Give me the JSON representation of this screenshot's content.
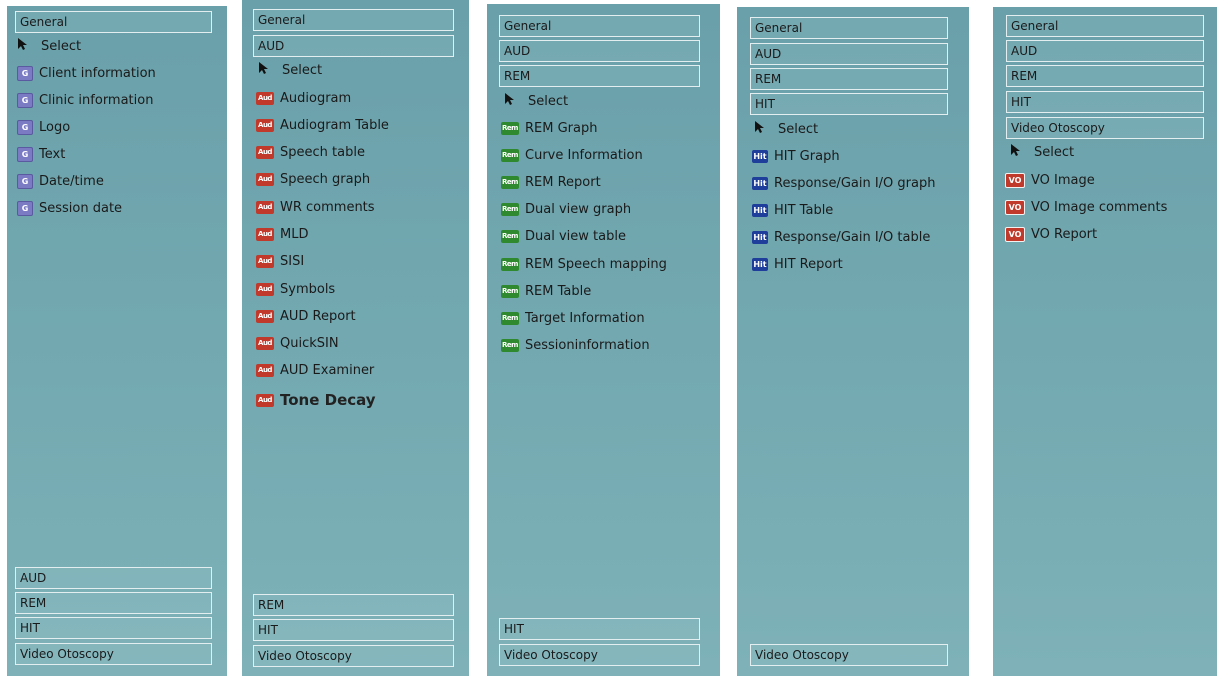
{
  "colors": {
    "panel": "#74a9b1",
    "aud_icon": "#c0392b",
    "rem_icon": "#2f8a2f",
    "hit_icon": "#1f3d9a",
    "general_icon": "#7b7bc4"
  },
  "icons": {
    "badge_general": "G",
    "badge_aud": "Aud",
    "badge_rem": "Rem",
    "badge_hit": "Hit",
    "badge_vo": "VO",
    "cursor": "arrow-cursor-icon"
  },
  "panels": [
    {
      "headers_top": [
        "General"
      ],
      "items": [
        "Select",
        "Client information",
        "Clinic information",
        "Logo",
        "Text",
        "Date/time",
        "Session date"
      ],
      "headers_bottom": [
        "AUD",
        "REM",
        "HIT",
        "Video Otoscopy"
      ]
    },
    {
      "headers_top": [
        "General",
        "AUD"
      ],
      "items": [
        "Select",
        "Audiogram",
        "Audiogram Table",
        "Speech table",
        "Speech graph",
        "WR comments",
        "MLD",
        "SISI",
        "Symbols",
        "AUD Report",
        "QuickSIN",
        "AUD Examiner",
        "Tone Decay"
      ],
      "headers_bottom": [
        "REM",
        "HIT",
        "Video Otoscopy"
      ]
    },
    {
      "headers_top": [
        "General",
        "AUD",
        "REM"
      ],
      "items": [
        "Select",
        "REM Graph",
        "Curve Information",
        "REM Report",
        "Dual view graph",
        "Dual view table",
        "REM Speech mapping",
        "REM Table",
        "Target Information",
        "Sessioninformation"
      ],
      "headers_bottom": [
        "HIT",
        "Video Otoscopy"
      ]
    },
    {
      "headers_top": [
        "General",
        "AUD",
        "REM",
        "HIT"
      ],
      "items": [
        "Select",
        "HIT Graph",
        "Response/Gain I/O graph",
        "HIT Table",
        "Response/Gain I/O table",
        "HIT Report"
      ],
      "headers_bottom": [
        "Video Otoscopy"
      ]
    },
    {
      "headers_top": [
        "General",
        "AUD",
        "REM",
        "HIT",
        "Video Otoscopy"
      ],
      "items": [
        "Select",
        "VO Image",
        "VO Image comments",
        "VO Report"
      ],
      "headers_bottom": []
    }
  ]
}
